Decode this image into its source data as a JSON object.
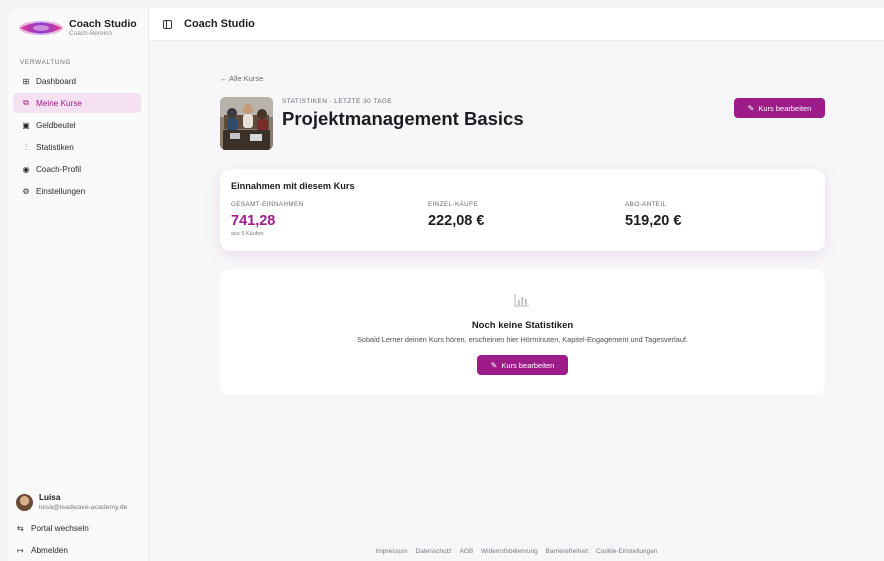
{
  "brand": {
    "title": "Coach Studio",
    "subtitle": "Coach-Bereich"
  },
  "sidebar": {
    "section_label": "VERWALTUNG",
    "items": [
      {
        "label": "Dashboard",
        "icon": "grid-icon",
        "active": false
      },
      {
        "label": "Meine Kurse",
        "icon": "book-icon",
        "active": true
      },
      {
        "label": "Geldbeutel",
        "icon": "wallet-icon",
        "active": false
      },
      {
        "label": "Statistiken",
        "icon": "chart-icon",
        "active": false
      },
      {
        "label": "Coach-Profil",
        "icon": "user-circle-icon",
        "active": false
      },
      {
        "label": "Einstellungen",
        "icon": "gear-icon",
        "active": false
      }
    ],
    "user": {
      "name": "Luisa",
      "email": "luisa@leadwave-academy.de"
    },
    "switch_label": "Portal wechseln",
    "logout_label": "Abmelden"
  },
  "topbar": {
    "title": "Coach Studio"
  },
  "course": {
    "back_label": "← Alle Kurse",
    "eyebrow": "STATISTIKEN · LETZTE 30 TAGE",
    "title": "Projektmanagement Basics",
    "edit_label": "Kurs bearbeiten"
  },
  "revenue": {
    "heading": "Einnahmen mit diesem Kurs",
    "total_label": "GESAMT-EINNAHMEN",
    "total_value": "741,28",
    "total_note": "aus 5 Käufen",
    "single_label": "EINZEL-KÄUFE",
    "single_value": "222,08 €",
    "abo_label": "ABO-ANTEIL",
    "abo_value": "519,20 €"
  },
  "empty_state": {
    "heading": "Noch keine Statistiken",
    "text": "Sobald Lerner deinen Kurs hören, erscheinen hier Hörminuten, Kapitel-Engagement und Tagesverlauf.",
    "button_label": "Kurs bearbeiten"
  },
  "footer": {
    "links": [
      "Impressum",
      "Datenschutz",
      "AGB",
      "Widerrufsbelehrung",
      "Barrierefreiheit",
      "Cookie-Einstellungen"
    ]
  },
  "colors": {
    "accent": "#9d1c8a",
    "active_bg": "#f5e1f1"
  }
}
